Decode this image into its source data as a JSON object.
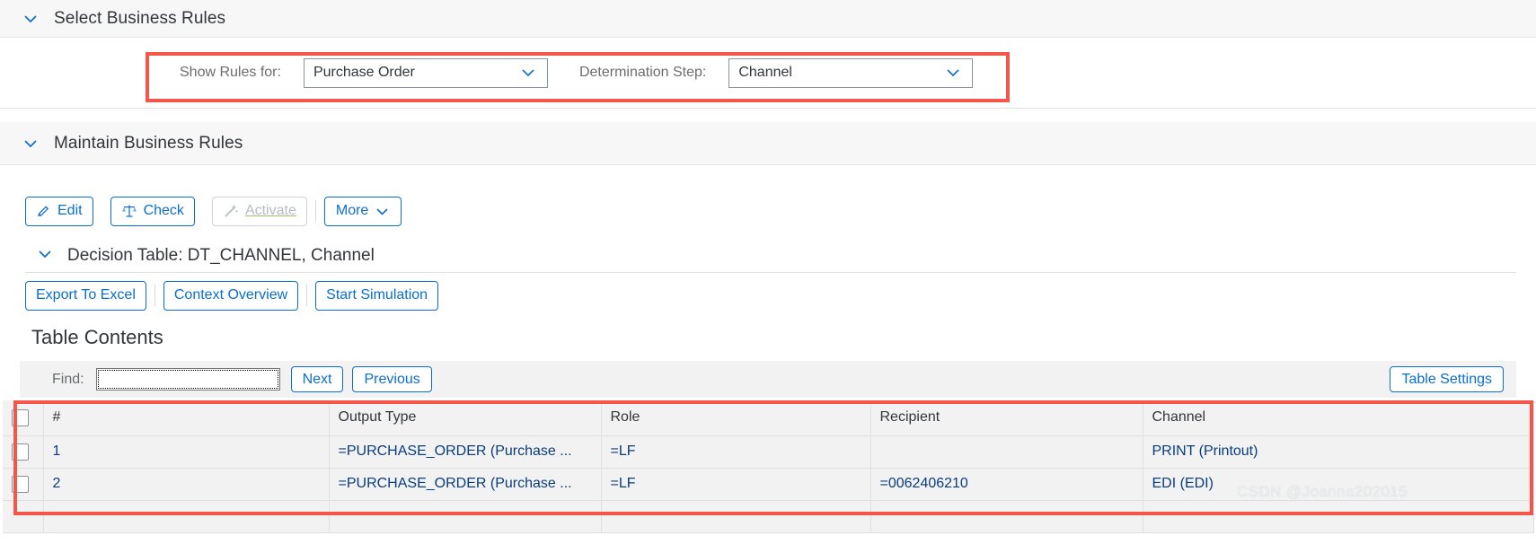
{
  "sections": {
    "select_business_rules": {
      "title": "Select Business Rules",
      "chevron_icon": "chevron-down-icon"
    },
    "maintain_business_rules": {
      "title": "Maintain Business Rules",
      "chevron_icon": "chevron-down-icon"
    },
    "decision_table": {
      "title": "Decision Table: DT_CHANNEL, Channel",
      "chevron_icon": "chevron-down-icon"
    }
  },
  "filters": {
    "show_rules_for": {
      "label": "Show Rules for:",
      "value": "Purchase Order",
      "arrow_icon": "chevron-down-icon"
    },
    "determination_step": {
      "label": "Determination Step:",
      "value": "Channel",
      "arrow_icon": "chevron-down-icon"
    },
    "highlight_color": "#f4564b"
  },
  "toolbar": {
    "edit": {
      "label": "Edit",
      "icon": "pencil-icon",
      "disabled": false
    },
    "check": {
      "label": "Check",
      "icon": "scales-icon",
      "disabled": false
    },
    "activate": {
      "label": "Activate",
      "icon": "magic-wand-icon",
      "disabled": true
    },
    "more": {
      "label": "More",
      "icon": "chevron-down-icon",
      "disabled": false
    }
  },
  "table_actions": {
    "export_to_excel": "Export To Excel",
    "context_overview": "Context Overview",
    "start_simulation": "Start Simulation"
  },
  "table_contents": {
    "heading": "Table Contents",
    "find": {
      "label": "Find:",
      "value": "",
      "placeholder": ""
    },
    "next_label": "Next",
    "previous_label": "Previous",
    "table_settings_label": "Table Settings"
  },
  "table": {
    "columns": [
      "#",
      "Output Type",
      "Role",
      "Recipient",
      "Channel"
    ],
    "rows": [
      {
        "num": "1",
        "output_type": "=PURCHASE_ORDER (Purchase ...",
        "role": "=LF",
        "recipient": "",
        "channel": "PRINT (Printout)",
        "channel_highlight": "#2ee06e",
        "selected": false
      },
      {
        "num": "2",
        "output_type": "=PURCHASE_ORDER (Purchase ...",
        "role": "=LF",
        "recipient": "=0062406210",
        "channel": "EDI (EDI)",
        "channel_highlight": "#2ee06e",
        "selected": false
      }
    ],
    "highlight_color": "#f4564b"
  },
  "watermark": {
    "text": "CSDN @Joanna202015"
  }
}
